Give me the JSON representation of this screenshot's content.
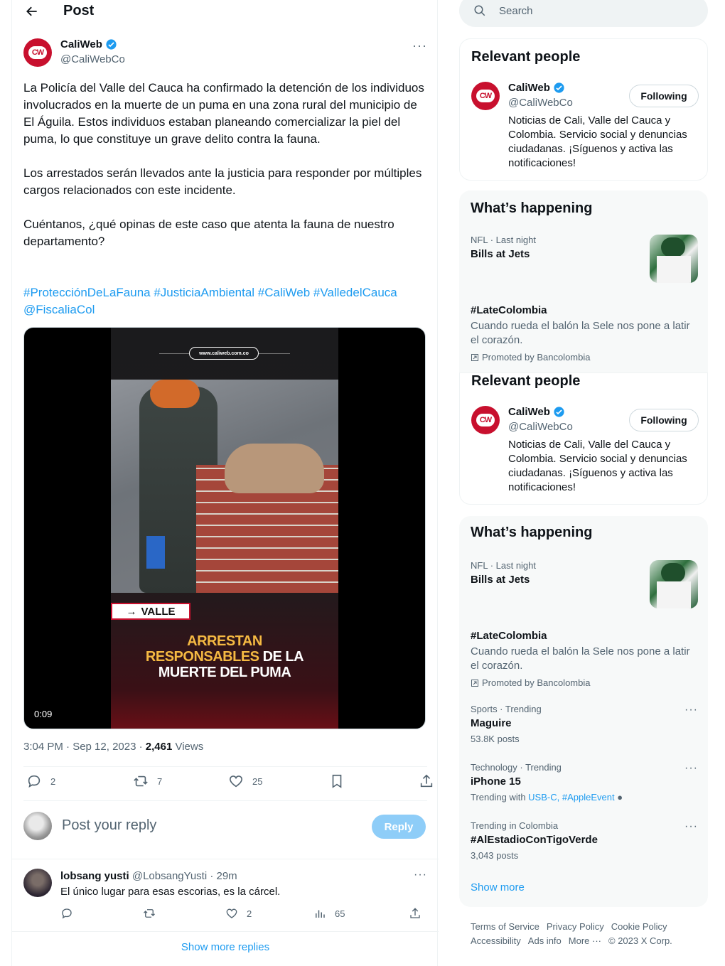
{
  "header": {
    "title": "Post"
  },
  "post": {
    "author_name": "CaliWeb",
    "author_handle": "@CaliWebCo",
    "avatar_text": "CW",
    "more": "···",
    "text": "La Policía del Valle del Cauca ha confirmado la detención de los individuos involucrados en la muerte de un puma en una zona rural del municipio de El Águila. Estos individuos estaban planeando comercializar la piel del puma, lo que constituye un grave delito contra la fauna.\n\nLos arrestados serán llevados ante la justicia para responder por múltiples cargos relacionados con este incidente.\n\nCuéntanos, ¿qué opinas de este caso que atenta la fauna de nuestro departamento?",
    "hashtags": "#ProtecciónDeLaFauna #JusticiaAmbiental #CaliWeb #ValledelCauca @FiscaliaCol",
    "video": {
      "site": "www.caliweb.com.co",
      "tag": "VALLE",
      "headline_yellow": "ARRESTAN",
      "headline_yellow2": "RESPONSABLES",
      "headline_white1": "DE LA",
      "headline_white2": "MUERTE DEL PUMA",
      "duration": "0:09"
    },
    "time": "3:04 PM · Sep 12, 2023 · ",
    "views_count": "2,461",
    "views_label": " Views",
    "stats": {
      "replies": "2",
      "reposts": "7",
      "likes": "25"
    }
  },
  "reply_box": {
    "placeholder": "Post your reply",
    "button": "Reply"
  },
  "comment": {
    "name": "lobsang yusti",
    "handle": " @LobsangYusti · 29m",
    "text": "El único lugar para esas escorias, es la cárcel.",
    "more": "···",
    "likes": "2",
    "views": "65"
  },
  "show_more_replies": "Show more replies",
  "sidebar": {
    "search_placeholder": "Search",
    "relevant_title": "Relevant people",
    "person": {
      "name": "CaliWeb",
      "handle": "@CaliWebCo",
      "avatar_text": "CW",
      "follow": "Following",
      "bio": "Noticias de Cali, Valle del Cauca y Colombia. Servicio social y denuncias ciudadanas. ¡Síguenos y activa las notificaciones!"
    },
    "happening_title": "What’s happening",
    "nfl": {
      "meta": "NFL · Last night",
      "title": "Bills at Jets"
    },
    "promo": {
      "title": "#LateColombia",
      "desc": "Cuando rueda el balón la Sele nos pone a latir el corazón.",
      "promoted": "Promoted by Bancolombia"
    },
    "trends": [
      {
        "meta": "Sports · Trending",
        "title": "Maguire",
        "sub": "53.8K posts"
      },
      {
        "meta": "Technology · Trending",
        "title": "iPhone 15",
        "sub_prefix": "Trending with ",
        "sub_link": "USB-C, #AppleEvent"
      },
      {
        "meta": "Trending in Colombia",
        "title": "#AlEstadioConTigoVerde",
        "sub": "3,043 posts"
      }
    ],
    "show_more": "Show more",
    "footer": {
      "terms": "Terms of Service",
      "privacy": "Privacy Policy",
      "cookie": "Cookie Policy",
      "accessibility": "Accessibility",
      "ads": "Ads info",
      "more": "More ···",
      "copyright": "© 2023 X Corp."
    }
  }
}
